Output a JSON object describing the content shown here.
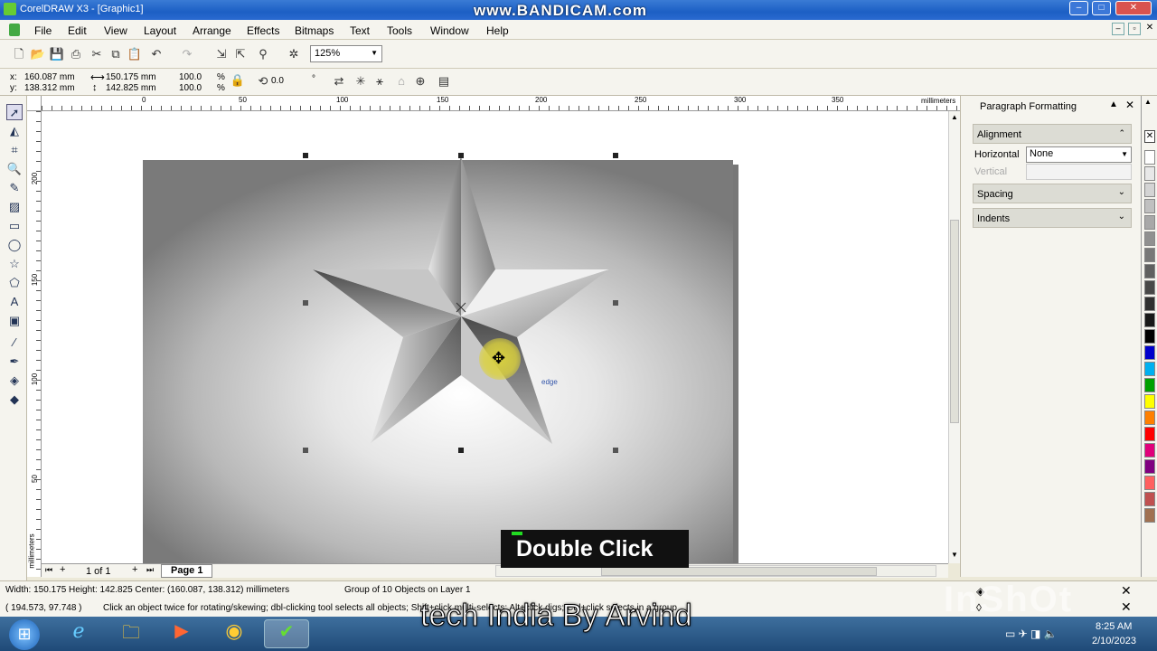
{
  "titlebar": {
    "title": "CorelDRAW X3 - [Graphic1]",
    "watermark": "www.BANDICAM.com",
    "min": "–",
    "max": "□",
    "close": "✕"
  },
  "menubar": {
    "items": [
      "File",
      "Edit",
      "View",
      "Layout",
      "Arrange",
      "Effects",
      "Bitmaps",
      "Text",
      "Tools",
      "Window",
      "Help"
    ]
  },
  "toolbar": {
    "zoom": "125%"
  },
  "propbar": {
    "x": "160.087 mm",
    "y": "138.312 mm",
    "width": "150.175 mm",
    "height": "142.825 mm",
    "scale_x": "100.0",
    "scale_y": "100.0",
    "pct1": "%",
    "pct2": "%",
    "rotation": "0.0",
    "deg": "°",
    "x_label": "x:",
    "y_label": "y:"
  },
  "ruler": {
    "h_ticks": [
      "0",
      "50",
      "100",
      "150",
      "200",
      "250",
      "300",
      "350"
    ],
    "h_unit": "millimeters",
    "v_ticks": [
      "200",
      "150",
      "100",
      "50"
    ],
    "v_unit": "millimeters"
  },
  "canvas": {
    "snap_label": "edge"
  },
  "pagebar": {
    "page_count": "1 of 1",
    "page_tab": "Page 1"
  },
  "docker": {
    "title": "Paragraph Formatting",
    "alignment": "Alignment",
    "horizontal_label": "Horizontal",
    "horizontal_value": "None",
    "vertical_label": "Vertical",
    "spacing": "Spacing",
    "indents": "Indents"
  },
  "palette": {
    "colors": [
      "#ffffff",
      "#e8e8e8",
      "#d4d4d4",
      "#c0c0c0",
      "#a8a8a8",
      "#909090",
      "#787878",
      "#606060",
      "#484848",
      "#303030",
      "#181818",
      "#000000",
      "#0000cc",
      "#00b0f0",
      "#00a000",
      "#ffff00",
      "#ff8000",
      "#ff0000",
      "#e0007a",
      "#800080",
      "#ff6060",
      "#c05050",
      "#a07050"
    ]
  },
  "status": {
    "line1": "Width: 150.175  Height: 142.825  Center: (160.087, 138.312)  millimeters",
    "line1b": "Group of 10 Objects on Layer 1",
    "line2a": "( 194.573, 97.748 )",
    "line2b": "Click an object twice for rotating/skewing; dbl-clicking tool selects all objects; Shift+click multi-selects; Alt+click digs; Ctrl+click selects in a group"
  },
  "taskbar": {
    "time": "8:25 AM",
    "date": "2/10/2023"
  },
  "overlay": {
    "caption": "Double Click",
    "footer": "tech India By Arvind",
    "brand": "InShOt"
  }
}
